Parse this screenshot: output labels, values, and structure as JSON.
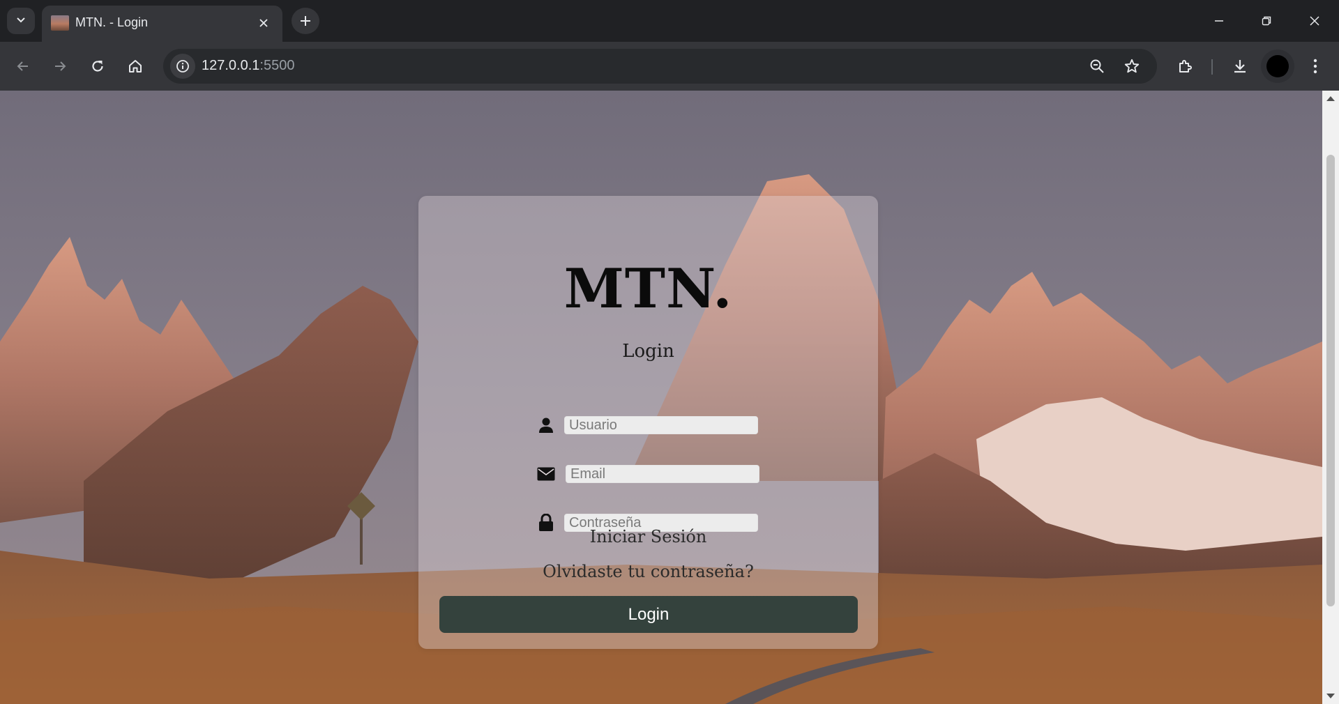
{
  "browser": {
    "tab_title": "MTN. - Login",
    "url_host": "127.0.0.1",
    "url_port": ":5500"
  },
  "login": {
    "brand": "MTN.",
    "subtitle": "Login",
    "username_placeholder": "Usuario",
    "email_placeholder": "Email",
    "password_placeholder": "Contraseña",
    "signin_label": "Iniciar Sesión",
    "forgot_label": "Olvidaste tu contraseña?",
    "button_label": "Login",
    "button_color": "#34423d"
  }
}
